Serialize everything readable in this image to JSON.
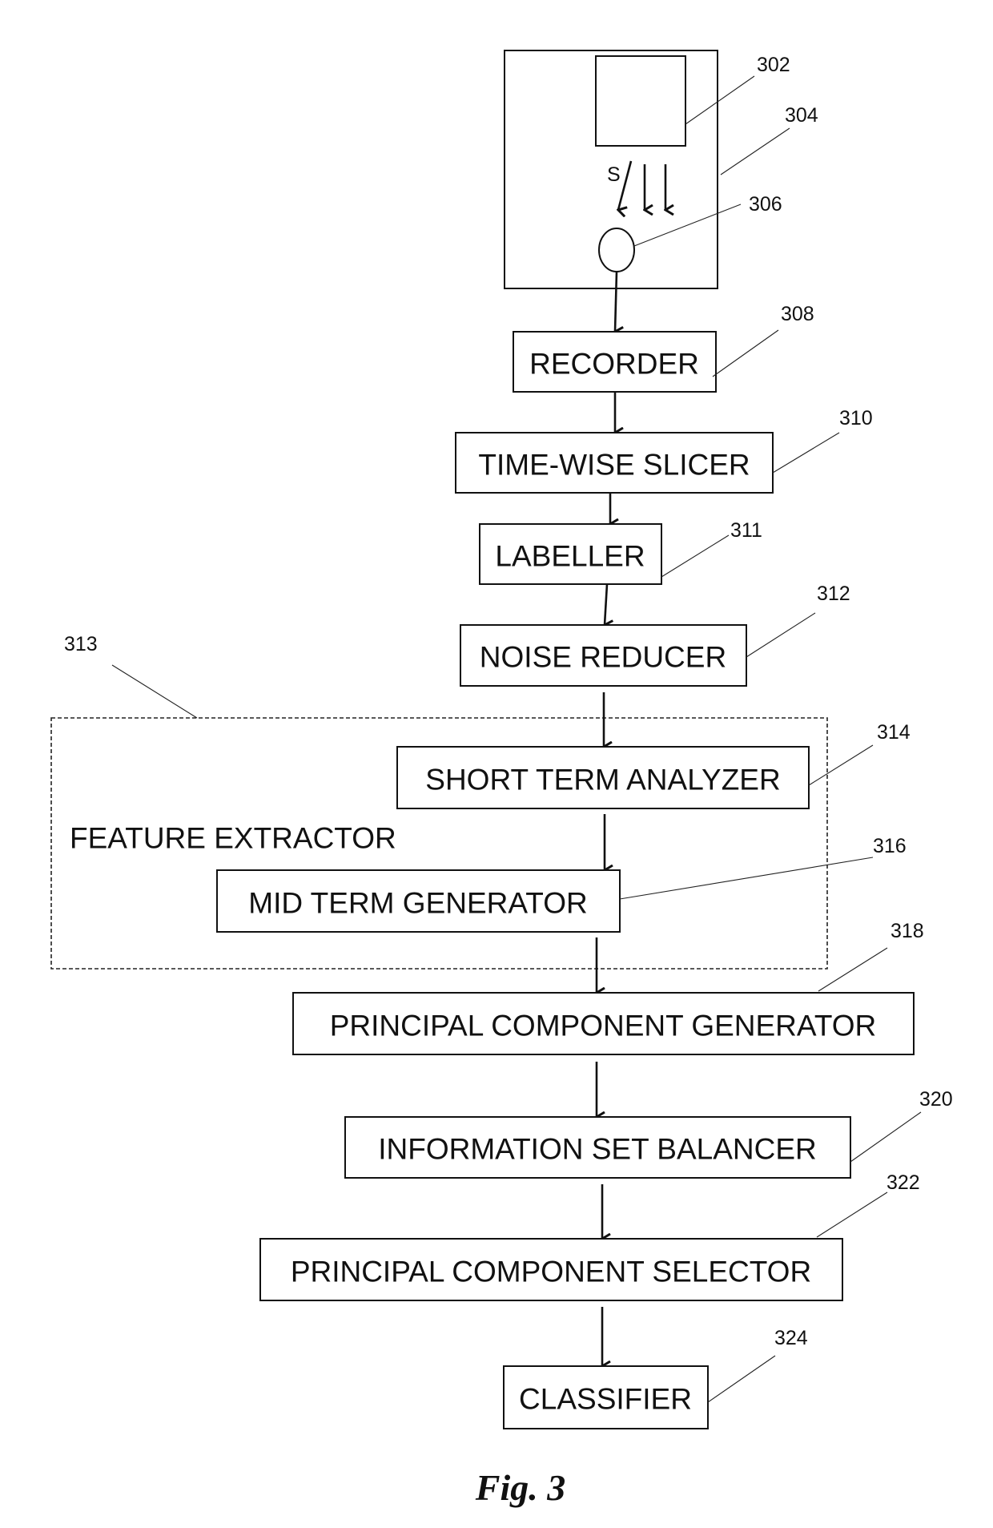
{
  "figure": {
    "caption": "Fig. 3",
    "device": {
      "ref_outer": "304",
      "ref_source": "302",
      "ref_sensor": "306",
      "signal_label": "S"
    },
    "group": {
      "label": "FEATURE EXTRACTOR",
      "ref": "313"
    },
    "blocks": [
      {
        "id": "recorder",
        "label": "RECORDER",
        "ref": "308"
      },
      {
        "id": "time-wise-slicer",
        "label": "TIME-WISE SLICER",
        "ref": "310"
      },
      {
        "id": "labeller",
        "label": "LABELLER",
        "ref": "311"
      },
      {
        "id": "noise-reducer",
        "label": "NOISE REDUCER",
        "ref": "312"
      },
      {
        "id": "short-term-analyzer",
        "label": "SHORT TERM ANALYZER",
        "ref": "314"
      },
      {
        "id": "mid-term-generator",
        "label": "MID TERM GENERATOR",
        "ref": "316"
      },
      {
        "id": "principal-component-generator",
        "label": "PRINCIPAL COMPONENT GENERATOR",
        "ref": "318"
      },
      {
        "id": "information-set-balancer",
        "label": "INFORMATION SET BALANCER",
        "ref": "320"
      },
      {
        "id": "principal-component-selector",
        "label": "PRINCIPAL COMPONENT SELECTOR",
        "ref": "322"
      },
      {
        "id": "classifier",
        "label": "CLASSIFIER",
        "ref": "324"
      }
    ],
    "flow": [
      [
        "sensor",
        "recorder"
      ],
      [
        "recorder",
        "time-wise-slicer"
      ],
      [
        "time-wise-slicer",
        "labeller"
      ],
      [
        "labeller",
        "noise-reducer"
      ],
      [
        "noise-reducer",
        "short-term-analyzer"
      ],
      [
        "short-term-analyzer",
        "mid-term-generator"
      ],
      [
        "mid-term-generator",
        "principal-component-generator"
      ],
      [
        "principal-component-generator",
        "information-set-balancer"
      ],
      [
        "information-set-balancer",
        "principal-component-selector"
      ],
      [
        "principal-component-selector",
        "classifier"
      ]
    ]
  }
}
